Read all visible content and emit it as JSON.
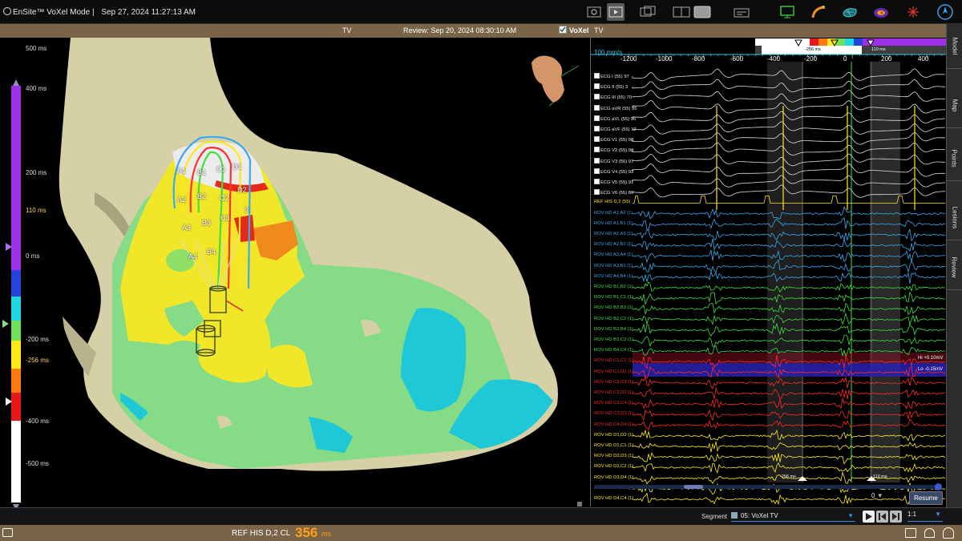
{
  "app": {
    "title": "EnSite™ VoXel Mode |",
    "datetime": "Sep 27, 2024 11:27:13 AM"
  },
  "infobar": {
    "left_label": "TV",
    "review": "Review: Sep 20, 2024 08:30:10 AM",
    "mode": "VoXel",
    "right_label": "TV"
  },
  "colorbar": {
    "labels": [
      "500 ms",
      "400 ms",
      "200 ms",
      "110 ms",
      "0 ms",
      "-200 ms",
      "-256 ms",
      "-400 ms",
      "-500 ms"
    ],
    "colors": [
      "#9b30e6",
      "#2443d8",
      "#1ed7e0",
      "#6ee05a",
      "#ffe81a",
      "#ff7a10",
      "#e81818",
      "#ffffff"
    ]
  },
  "map_labels": [
    "A1",
    "B1",
    "C1",
    "D1",
    "A2",
    "B2",
    "C2",
    "D2",
    "A3",
    "B3",
    "C3",
    "3",
    "A4",
    "B4"
  ],
  "trace": {
    "speed": "100 mm/s",
    "ticks": [
      "-1200",
      "-1000",
      "-800",
      "-600",
      "-400",
      "-200",
      "0",
      "200",
      "400"
    ],
    "window_left": "-256 ms",
    "window_right": "110 ms",
    "channels": [
      {
        "label": "ECG I (55)  97",
        "color": "#ffffff",
        "check": true
      },
      {
        "label": "ECG II (55)  3",
        "color": "#ffffff",
        "check": true
      },
      {
        "label": "ECG III (55)  70",
        "color": "#ffffff",
        "check": true
      },
      {
        "label": "ECG aVR (55)  95",
        "color": "#ffffff",
        "check": true
      },
      {
        "label": "ECG aVL (55)  96",
        "color": "#ffffff",
        "check": true
      },
      {
        "label": "ECG aVF (55)  12",
        "color": "#ffffff",
        "check": true
      },
      {
        "label": "ECG V1 (55)  98",
        "color": "#ffffff",
        "check": true
      },
      {
        "label": "ECG V2 (55)  98",
        "color": "#ffffff",
        "check": true
      },
      {
        "label": "ECG V3 (55)  97",
        "color": "#ffffff",
        "check": true
      },
      {
        "label": "ECG V4 (55)  93",
        "color": "#ffffff",
        "check": true
      },
      {
        "label": "ECG V5 (55)  91",
        "color": "#ffffff",
        "check": true
      },
      {
        "label": "ECG V6 (55)  86",
        "color": "#ffffff",
        "check": true
      },
      {
        "label": "REF HIS D,2 (55)",
        "color": "#ffe81a",
        "check": false
      },
      {
        "label": "ROV HD A1,A2 (1)",
        "color": "#39a9f0",
        "check": false
      },
      {
        "label": "ROV HD A1,B1 (1)",
        "color": "#39a9f0",
        "check": false
      },
      {
        "label": "ROV HD A2,A3 (1)",
        "color": "#39a9f0",
        "check": false
      },
      {
        "label": "ROV HD A2,B2 (1)",
        "color": "#39a9f0",
        "check": false
      },
      {
        "label": "ROV HD A3,A4 (1)",
        "color": "#39a9f0",
        "check": false
      },
      {
        "label": "ROV HD A3,B3 (1)",
        "color": "#39a9f0",
        "check": false
      },
      {
        "label": "ROV HD A4,B4 (1)",
        "color": "#39a9f0",
        "check": false
      },
      {
        "label": "ROV HD B1,B2 (1)",
        "color": "#3ee03e",
        "check": false
      },
      {
        "label": "ROV HD B1,C1 (1)",
        "color": "#3ee03e",
        "check": false
      },
      {
        "label": "ROV HD B2,B3 (1)",
        "color": "#3ee03e",
        "check": false
      },
      {
        "label": "ROV HD B2,C2 (1)",
        "color": "#3ee03e",
        "check": false
      },
      {
        "label": "ROV HD B3,B4 (1)",
        "color": "#3ee03e",
        "check": false
      },
      {
        "label": "ROV HD B3,C3 (1)",
        "color": "#3ee03e",
        "check": false
      },
      {
        "label": "ROV HD B4,C4 (1)",
        "color": "#3ee03e",
        "check": false
      },
      {
        "label": "ROV HD C1,C2 (1)",
        "color": "#ff2a2a",
        "check": false
      },
      {
        "label": "ROV HD C1,D1 (1)",
        "color": "#ff2a2a",
        "check": false
      },
      {
        "label": "ROV HD C2,C3 (1)",
        "color": "#ff2a2a",
        "check": false
      },
      {
        "label": "ROV HD C2,D2 (1)",
        "color": "#ff2a2a",
        "check": false
      },
      {
        "label": "ROV HD C3,C4 (1)",
        "color": "#ff2a2a",
        "check": false
      },
      {
        "label": "ROV HD C3,D3 (1)",
        "color": "#ff2a2a",
        "check": false
      },
      {
        "label": "ROV HD C4,D4 (1)",
        "color": "#ff2a2a",
        "check": false
      },
      {
        "label": "ROV HD D1,D2 (1)",
        "color": "#ffee22",
        "check": false
      },
      {
        "label": "ROV HD D1,C1 (1)",
        "color": "#ffee22",
        "check": false
      },
      {
        "label": "ROV HD D2,D3 (1)",
        "color": "#ffee22",
        "check": false
      },
      {
        "label": "ROV HD D2,C2 (1)",
        "color": "#ffee22",
        "check": false
      },
      {
        "label": "ROV HD D3,D4 (1)",
        "color": "#ffee22",
        "check": false
      },
      {
        "label": "ROV HD D3,C3 (1)",
        "color": "#ffee22",
        "check": false
      },
      {
        "label": "ROV HD D4,C4 (1)",
        "color": "#ffee22",
        "check": false
      }
    ],
    "threshold_hi": "Hi +0.10mV",
    "threshold_lo": "Lo -0.15mV",
    "marker_left": "-256 ms",
    "marker_right": "110 ms"
  },
  "right_tabs": [
    "Model",
    "Map",
    "Points",
    "Lesions",
    "Review"
  ],
  "controls": {
    "counter": "0",
    "resume": "Resume",
    "segment_label": "Segment",
    "segment_value": "05: VoXel TV",
    "scale": "1:1"
  },
  "status": {
    "ref_label": "REF HIS D,2 CL",
    "cl_value": "356",
    "cl_unit": "ms"
  }
}
